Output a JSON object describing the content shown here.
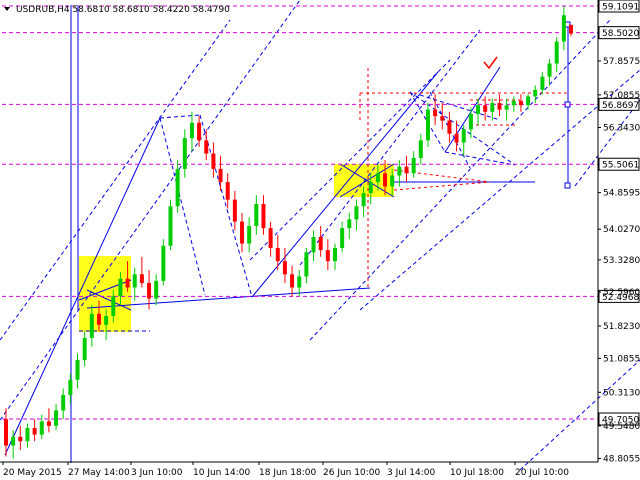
{
  "colors": {
    "background": "#ffffff",
    "up": "#00cc00",
    "down": "#ff0000",
    "trend": "#0000ee",
    "level": "#dd00dd",
    "zone": "#ffff00",
    "axis": "#000000"
  },
  "chart_data": {
    "type": "candlestick",
    "title": "USDRUB,H4  58.6810 58.6810 58.4220 58.4790",
    "x_ticks": [
      "20 May 2015",
      "27 May 14:00",
      "3 Jun 10:00",
      "10 Jun 14:00",
      "18 Jun 18:00",
      "26 Jun 10:00",
      "3 Jul 14:00",
      "10 Jul 18:00",
      "20 Jul 10:00"
    ],
    "y_ticks": [
      57.8575,
      57.0855,
      56.343,
      54.8595,
      54.027,
      53.328,
      52.596,
      51.823,
      51.0855,
      50.313,
      49.548,
      48.8055
    ],
    "ylim": [
      48.7,
      59.2
    ],
    "level_badges": [
      59.1091,
      58.502,
      56.8697,
      55.5061,
      52.4968,
      49.705
    ],
    "candles": [
      [
        49.7,
        49.95,
        48.85,
        49.1
      ],
      [
        49.1,
        49.45,
        48.8,
        49.3
      ],
      [
        49.3,
        49.55,
        49.0,
        49.2
      ],
      [
        49.2,
        49.6,
        49.05,
        49.5
      ],
      [
        49.5,
        49.7,
        49.2,
        49.35
      ],
      [
        49.35,
        49.8,
        49.25,
        49.65
      ],
      [
        49.65,
        49.95,
        49.4,
        49.55
      ],
      [
        49.55,
        50.05,
        49.45,
        49.9
      ],
      [
        49.9,
        50.4,
        49.7,
        50.25
      ],
      [
        50.25,
        50.75,
        50.05,
        50.6
      ],
      [
        50.6,
        51.2,
        50.4,
        51.05
      ],
      [
        51.05,
        51.7,
        50.9,
        51.55
      ],
      [
        51.55,
        52.3,
        51.35,
        52.1
      ],
      [
        52.1,
        52.4,
        51.7,
        51.85
      ],
      [
        51.85,
        52.2,
        51.5,
        52.05
      ],
      [
        52.05,
        52.65,
        51.9,
        52.5
      ],
      [
        52.5,
        53.05,
        52.3,
        52.9
      ],
      [
        52.9,
        53.3,
        52.6,
        52.7
      ],
      [
        52.7,
        53.15,
        52.4,
        53.0
      ],
      [
        53.0,
        53.4,
        52.7,
        52.8
      ],
      [
        52.8,
        53.1,
        52.2,
        52.45
      ],
      [
        52.45,
        53.0,
        52.3,
        52.85
      ],
      [
        52.85,
        53.8,
        52.75,
        53.65
      ],
      [
        53.65,
        54.7,
        53.55,
        54.55
      ],
      [
        54.55,
        55.6,
        54.4,
        55.4
      ],
      [
        55.4,
        56.3,
        55.2,
        56.1
      ],
      [
        56.1,
        56.7,
        55.8,
        56.45
      ],
      [
        56.45,
        56.6,
        55.9,
        56.05
      ],
      [
        56.05,
        56.3,
        55.6,
        55.75
      ],
      [
        55.75,
        56.0,
        55.2,
        55.4
      ],
      [
        55.4,
        55.7,
        54.9,
        55.1
      ],
      [
        55.1,
        55.3,
        54.5,
        54.7
      ],
      [
        54.7,
        54.9,
        54.0,
        54.2
      ],
      [
        54.2,
        54.4,
        53.5,
        53.7
      ],
      [
        53.7,
        54.3,
        53.5,
        54.1
      ],
      [
        54.1,
        54.8,
        53.9,
        54.6
      ],
      [
        54.6,
        54.8,
        53.9,
        54.05
      ],
      [
        54.05,
        54.2,
        53.4,
        53.6
      ],
      [
        53.6,
        53.9,
        53.1,
        53.3
      ],
      [
        53.3,
        53.6,
        52.8,
        53.0
      ],
      [
        53.0,
        53.2,
        52.5,
        52.7
      ],
      [
        52.7,
        53.1,
        52.5,
        52.95
      ],
      [
        52.95,
        53.6,
        52.8,
        53.5
      ],
      [
        53.5,
        54.0,
        53.3,
        53.85
      ],
      [
        53.85,
        54.1,
        53.4,
        53.55
      ],
      [
        53.55,
        53.8,
        53.1,
        53.3
      ],
      [
        53.3,
        53.7,
        53.1,
        53.6
      ],
      [
        53.6,
        54.2,
        53.5,
        54.05
      ],
      [
        54.05,
        54.4,
        53.8,
        54.25
      ],
      [
        54.25,
        54.7,
        54.0,
        54.55
      ],
      [
        54.55,
        55.0,
        54.3,
        54.85
      ],
      [
        54.85,
        55.3,
        54.6,
        55.1
      ],
      [
        55.1,
        55.5,
        54.9,
        55.3
      ],
      [
        55.3,
        55.6,
        54.8,
        55.0
      ],
      [
        55.0,
        55.4,
        54.8,
        55.25
      ],
      [
        55.25,
        55.6,
        55.0,
        55.45
      ],
      [
        55.45,
        55.7,
        55.1,
        55.3
      ],
      [
        55.3,
        55.8,
        55.2,
        55.65
      ],
      [
        55.65,
        56.2,
        55.5,
        56.05
      ],
      [
        56.05,
        56.9,
        55.9,
        56.75
      ],
      [
        56.75,
        57.1,
        56.4,
        56.6
      ],
      [
        56.6,
        56.9,
        56.3,
        56.5
      ],
      [
        56.5,
        56.7,
        56.0,
        56.2
      ],
      [
        56.2,
        56.5,
        55.8,
        56.0
      ],
      [
        56.0,
        56.4,
        55.7,
        56.3
      ],
      [
        56.3,
        56.8,
        56.1,
        56.65
      ],
      [
        56.65,
        57.0,
        56.4,
        56.85
      ],
      [
        56.85,
        57.05,
        56.5,
        56.7
      ],
      [
        56.7,
        57.0,
        56.5,
        56.9
      ],
      [
        56.9,
        57.1,
        56.6,
        56.75
      ],
      [
        56.75,
        57.0,
        56.5,
        56.85
      ],
      [
        56.85,
        57.05,
        56.7,
        56.95
      ],
      [
        56.95,
        57.1,
        56.7,
        56.85
      ],
      [
        56.85,
        57.1,
        56.75,
        57.05
      ],
      [
        57.05,
        57.3,
        56.9,
        57.2
      ],
      [
        57.2,
        57.6,
        57.1,
        57.5
      ],
      [
        57.5,
        57.9,
        57.3,
        57.8
      ],
      [
        57.8,
        58.4,
        57.6,
        58.3
      ],
      [
        58.3,
        59.1,
        58.1,
        58.9
      ],
      [
        58.68,
        58.68,
        58.42,
        58.48
      ]
    ]
  }
}
